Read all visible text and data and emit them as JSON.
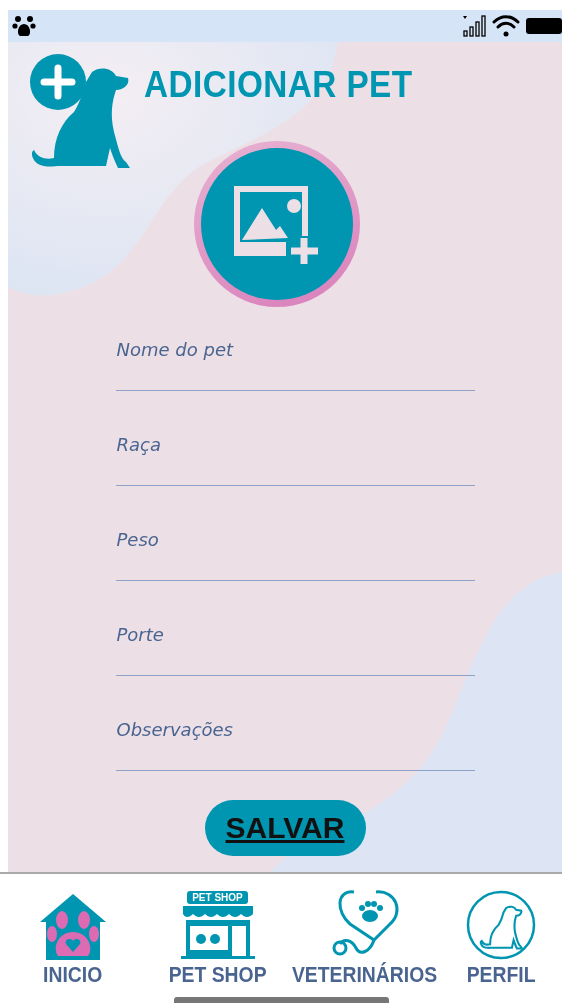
{
  "header": {
    "title": "ADICIONAR PET"
  },
  "fields": [
    {
      "placeholder": "Nome do pet"
    },
    {
      "placeholder": "Raça"
    },
    {
      "placeholder": "Peso"
    },
    {
      "placeholder": "Porte"
    },
    {
      "placeholder": "Observações"
    }
  ],
  "save_button": "SALVAR",
  "nav": [
    {
      "kind": "home",
      "label": "INICIO"
    },
    {
      "kind": "shop",
      "label": "PET SHOP",
      "sign": "PET SHOP"
    },
    {
      "kind": "vet",
      "label": "VETERINÁRIOS"
    },
    {
      "kind": "profile",
      "label": "PERFIL"
    }
  ]
}
